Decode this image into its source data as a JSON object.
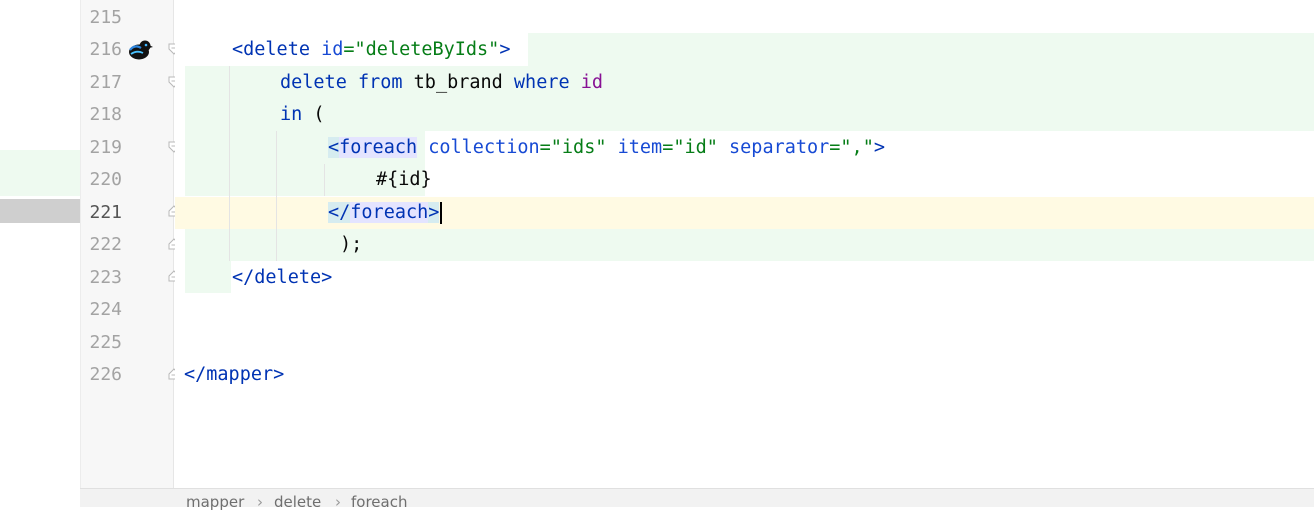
{
  "line_numbers": [
    "215",
    "216",
    "217",
    "218",
    "219",
    "220",
    "221",
    "222",
    "223",
    "224",
    "225",
    "226"
  ],
  "code": {
    "l216": {
      "open": "<",
      "tag": "delete",
      "attr": "id",
      "eq": "=",
      "val": "\"deleteByIds\"",
      "close": ">"
    },
    "l217": {
      "kw1": "delete",
      "kw2": "from",
      "table": "tb_brand",
      "kw3": "where",
      "col": "id"
    },
    "l218": {
      "kw": "in",
      "paren": "("
    },
    "l219": {
      "open": "<",
      "tag": "foreach",
      "attr1": "collection",
      "val1": "\"ids\"",
      "attr2": "item",
      "val2": "\"id\"",
      "attr3": "separator",
      "val3": "\",\"",
      "close": ">"
    },
    "l220": {
      "expr": "#{id}"
    },
    "l221": {
      "open": "</",
      "tag": "foreach",
      "close": ">"
    },
    "l222": {
      "text": ");"
    },
    "l223": {
      "open": "</",
      "tag": "delete",
      "close": ">"
    },
    "l226": {
      "open": "</",
      "tag": "mapper",
      "close": ">"
    }
  },
  "breadcrumb": [
    "mapper",
    "delete",
    "foreach"
  ],
  "icons": {
    "avatar": "bird-avatar-icon",
    "bulb": "lightbulb-icon",
    "fold": "fold-marker-icon",
    "separator": "chevron-right-icon"
  },
  "colors": {
    "diff_added": "#eefaf0",
    "current_line": "#fffae3",
    "tag": "#0033b3",
    "attr": "#174ad4",
    "value": "#067d17",
    "column": "#871094"
  }
}
